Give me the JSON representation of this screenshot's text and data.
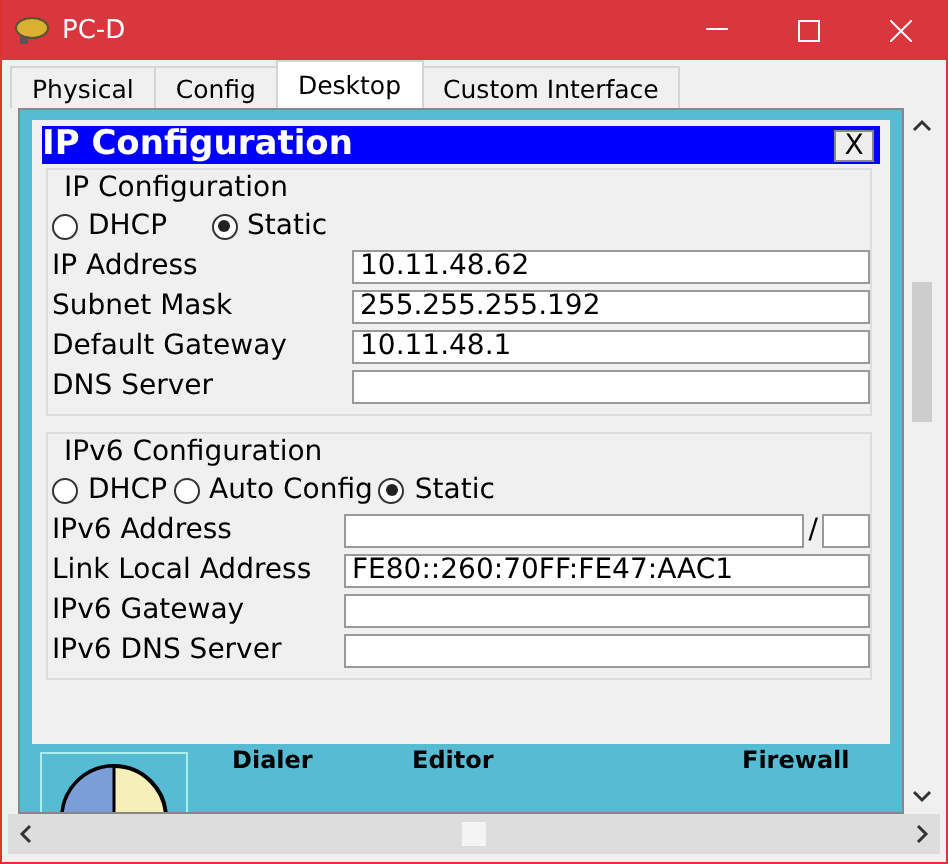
{
  "window": {
    "title": "PC-D"
  },
  "tabs": [
    {
      "label": "Physical",
      "selected": false
    },
    {
      "label": "Config",
      "selected": false
    },
    {
      "label": "Desktop",
      "selected": true
    },
    {
      "label": "Custom Interface",
      "selected": false
    }
  ],
  "dialog": {
    "title": "IP Configuration",
    "close": "X",
    "ipv4": {
      "title": "IP Configuration",
      "modes": [
        {
          "label": "DHCP",
          "selected": false
        },
        {
          "label": "Static",
          "selected": true
        }
      ],
      "fields": [
        {
          "label": "IP Address",
          "value": "10.11.48.62"
        },
        {
          "label": "Subnet Mask",
          "value": "255.255.255.192"
        },
        {
          "label": "Default Gateway",
          "value": "10.11.48.1"
        },
        {
          "label": "DNS Server"
        }
      ]
    },
    "ipv6": {
      "title": "IPv6 Configuration",
      "modes": [
        {
          "label": "DHCP",
          "selected": false
        },
        {
          "label": "Auto Config",
          "selected": false
        },
        {
          "label": "Static",
          "selected": true
        }
      ],
      "fields": [
        {
          "label": "IPv6 Address",
          "prefix_separator": "/"
        },
        {
          "label": "Link Local Address",
          "value": "FE80::260:70FF:FE47:AAC1"
        },
        {
          "label": "IPv6 Gateway"
        },
        {
          "label": "IPv6 DNS Server"
        }
      ]
    }
  },
  "desktop_apps": [
    {
      "label": "Dialer"
    },
    {
      "label": "Editor"
    },
    {
      "label": "Firewall"
    }
  ]
}
